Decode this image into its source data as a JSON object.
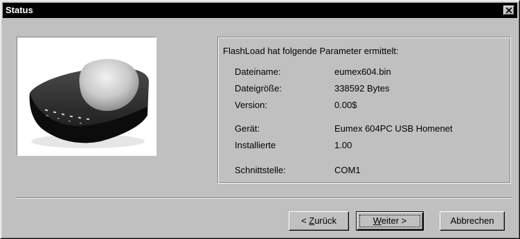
{
  "window": {
    "title": "Status"
  },
  "info": {
    "heading": "FlashLoad hat folgende Parameter ermittelt:",
    "rows": [
      {
        "label": "Dateiname:",
        "value": "eumex604.bin"
      },
      {
        "label": "Dateigröße:",
        "value": "338592 Bytes"
      },
      {
        "label": "Version:",
        "value": "0.00$"
      },
      {
        "label": "Gerät:",
        "value": "Eumex 604PC USB Homenet"
      },
      {
        "label": "Installierte",
        "value": "1.00"
      },
      {
        "label": "Schnittstelle:",
        "value": "COM1"
      }
    ]
  },
  "buttons": {
    "back": {
      "prefix": "< ",
      "mnemonic": "Z",
      "rest": "urück"
    },
    "next": {
      "mnemonic": "W",
      "rest": "eiter",
      "suffix": " >"
    },
    "cancel": {
      "label": "Abbrechen"
    }
  },
  "colors": {
    "face": "#c0c0c0",
    "titlebar": "#000000",
    "title_text": "#ffffff"
  },
  "icons": {
    "close": "close-icon",
    "device": "modem-device-image"
  }
}
